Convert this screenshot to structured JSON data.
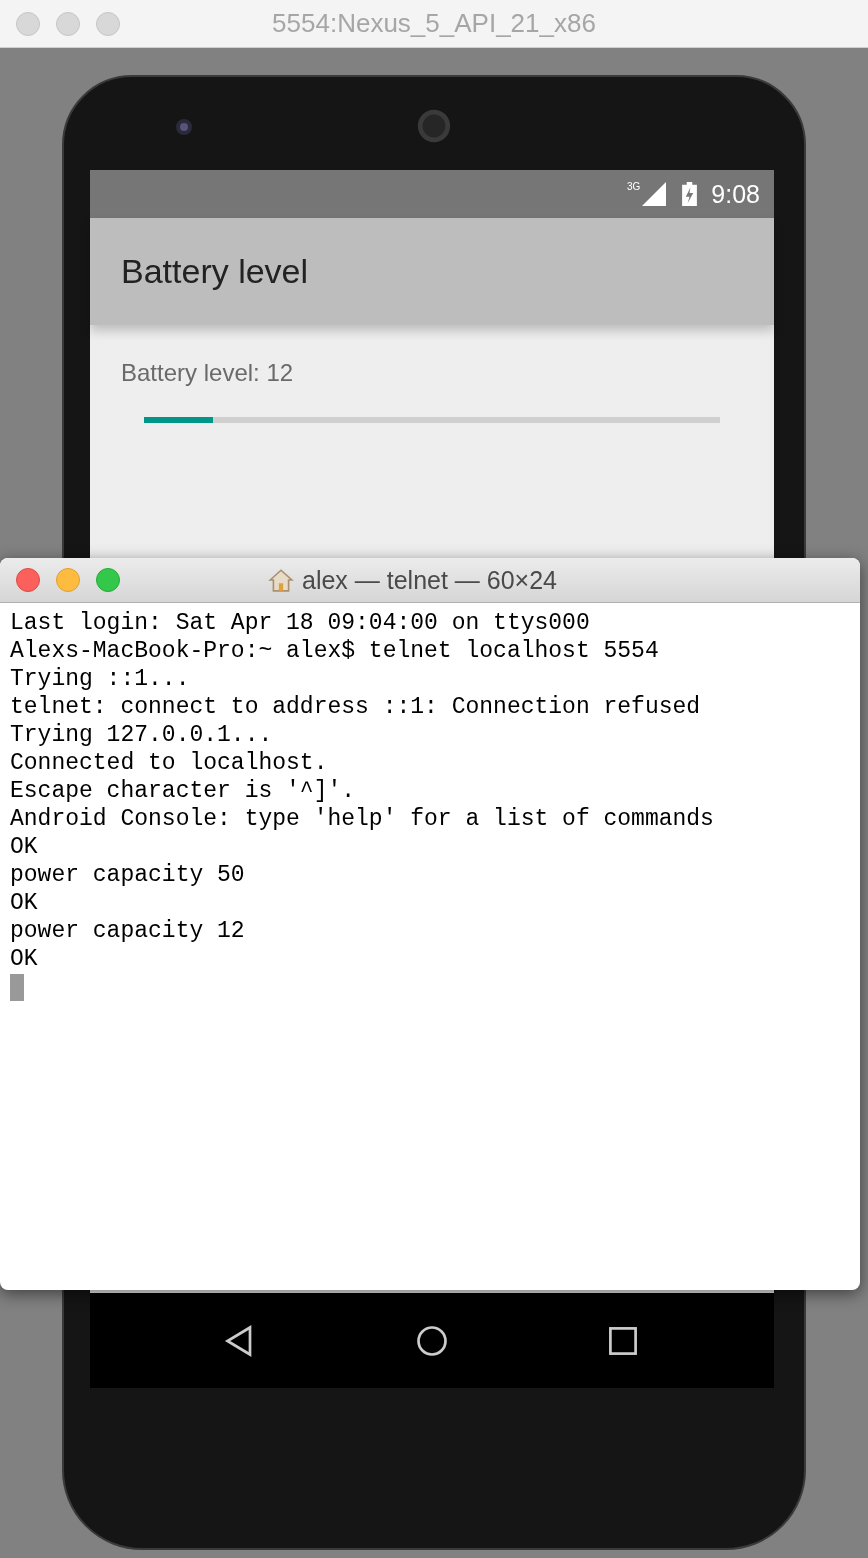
{
  "emulator_window": {
    "title": "5554:Nexus_5_API_21_x86"
  },
  "phone": {
    "status_bar": {
      "network": "3G",
      "time": "9:08"
    },
    "app_bar": {
      "title": "Battery level"
    },
    "content": {
      "label": "Battery level: 12",
      "progress": {
        "level": 0.12
      }
    }
  },
  "terminal_window": {
    "title": "alex — telnet — 60×24",
    "lines": [
      "Last login: Sat Apr 18 09:04:00 on ttys000",
      "Alexs-MacBook-Pro:~ alex$ telnet localhost 5554",
      "Trying ::1...",
      "telnet: connect to address ::1: Connection refused",
      "Trying 127.0.0.1...",
      "Connected to localhost.",
      "Escape character is '^]'.",
      "Android Console: type 'help' for a list of commands",
      "OK",
      "power capacity 50",
      "OK",
      "power capacity 12",
      "OK"
    ]
  }
}
